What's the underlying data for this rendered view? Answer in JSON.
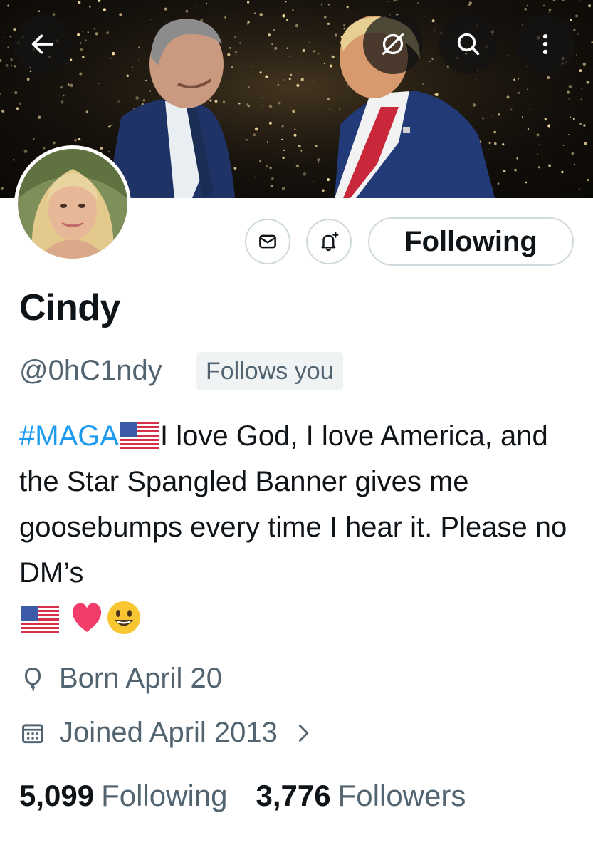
{
  "header": {
    "back_icon": "arrow-left-icon",
    "block_icon": "eye-slash-icon",
    "search_icon": "search-icon",
    "more_icon": "more-vertical-icon"
  },
  "profile": {
    "display_name": "Cindy",
    "handle": "@0hC1ndy",
    "follows_you_badge": "Follows you",
    "follow_button_label": "Following",
    "message_icon": "envelope-icon",
    "notify_icon": "bell-plus-icon"
  },
  "bio": {
    "hashtag": "#MAGA",
    "text_1": "I love God, I love America, and the Star Spangled Banner gives me goosebumps every time I hear it. Please no DM’s"
  },
  "meta": {
    "born": "Born April 20",
    "joined": "Joined April 2013",
    "born_icon": "balloon-icon",
    "joined_icon": "calendar-icon"
  },
  "stats": {
    "following_count": "5,099",
    "following_label": "Following",
    "followers_count": "3,776",
    "followers_label": "Followers"
  },
  "colors": {
    "link_blue": "#1d9bf0",
    "secondary_text": "#536471",
    "primary_text": "#0f1419",
    "border": "#cfd9de"
  }
}
